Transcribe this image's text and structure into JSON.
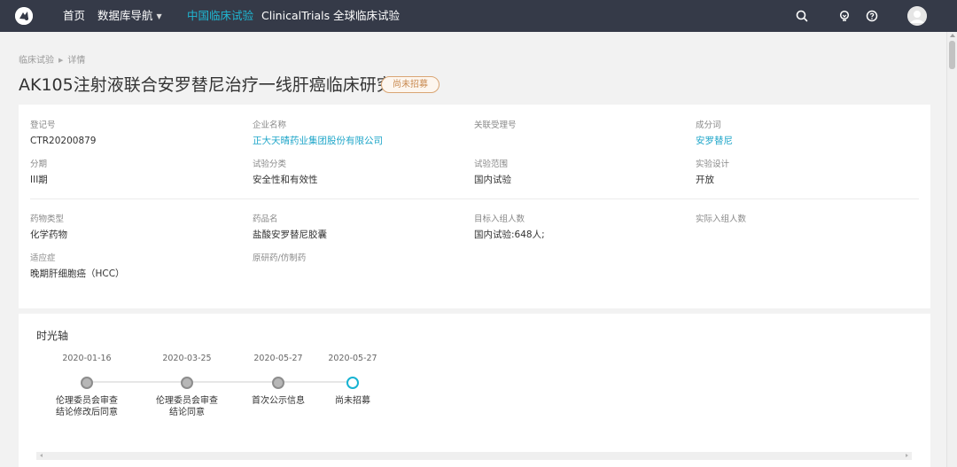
{
  "nav": {
    "items": [
      {
        "label": "首页"
      },
      {
        "label": "数据库导航"
      },
      {
        "label": "中国临床试验"
      },
      {
        "label": "ClinicalTrials"
      },
      {
        "label": "全球临床试验"
      }
    ],
    "active_index": 2,
    "icons": [
      "logo-icon",
      "search-icon",
      "bulb-icon",
      "help-icon",
      "user-avatar-icon"
    ],
    "accent_color": "#1fb8d4",
    "bar_color": "#353a48"
  },
  "breadcrumb": [
    "临床试验",
    "详情"
  ],
  "title": "AK105注射液联合安罗替尼治疗一线肝癌临床研究",
  "status": "尚未招募",
  "info": {
    "reg_no": {
      "label": "登记号",
      "value": "CTR20200879"
    },
    "company": {
      "label": "企业名称",
      "value": "正大天晴药业集团股份有限公司"
    },
    "accept_no": {
      "label": "关联受理号",
      "value": ""
    },
    "ingredient": {
      "label": "成分词",
      "value": "安罗替尼"
    },
    "phase": {
      "label": "分期",
      "value": "III期"
    },
    "category": {
      "label": "试验分类",
      "value": "安全性和有效性"
    },
    "scope": {
      "label": "试验范围",
      "value": "国内试验"
    },
    "design": {
      "label": "实验设计",
      "value": "开放"
    },
    "drug_type": {
      "label": "药物类型",
      "value": "化学药物"
    },
    "drug_name": {
      "label": "药品名",
      "value": "盐酸安罗替尼胶囊"
    },
    "target_enroll": {
      "label": "目标入组人数",
      "value": "国内试验:648人;"
    },
    "actual_enroll": {
      "label": "实际入组人数",
      "value": ""
    },
    "indication": {
      "label": "适应症",
      "value": "晚期肝细胞癌（HCC）"
    },
    "generic": {
      "label": "原研药/仿制药",
      "value": ""
    }
  },
  "timeline": {
    "title": "时光轴",
    "steps": [
      {
        "date": "2020-01-16",
        "label1": "伦理委员会审查",
        "label2": "结论修改后同意",
        "current": false
      },
      {
        "date": "2020-03-25",
        "label1": "伦理委员会审查",
        "label2": "结论同意",
        "current": false
      },
      {
        "date": "2020-05-27",
        "label1": "首次公示信息",
        "label2": "",
        "current": false
      },
      {
        "date": "2020-05-27",
        "label1": "尚未招募",
        "label2": "",
        "current": true
      }
    ]
  }
}
